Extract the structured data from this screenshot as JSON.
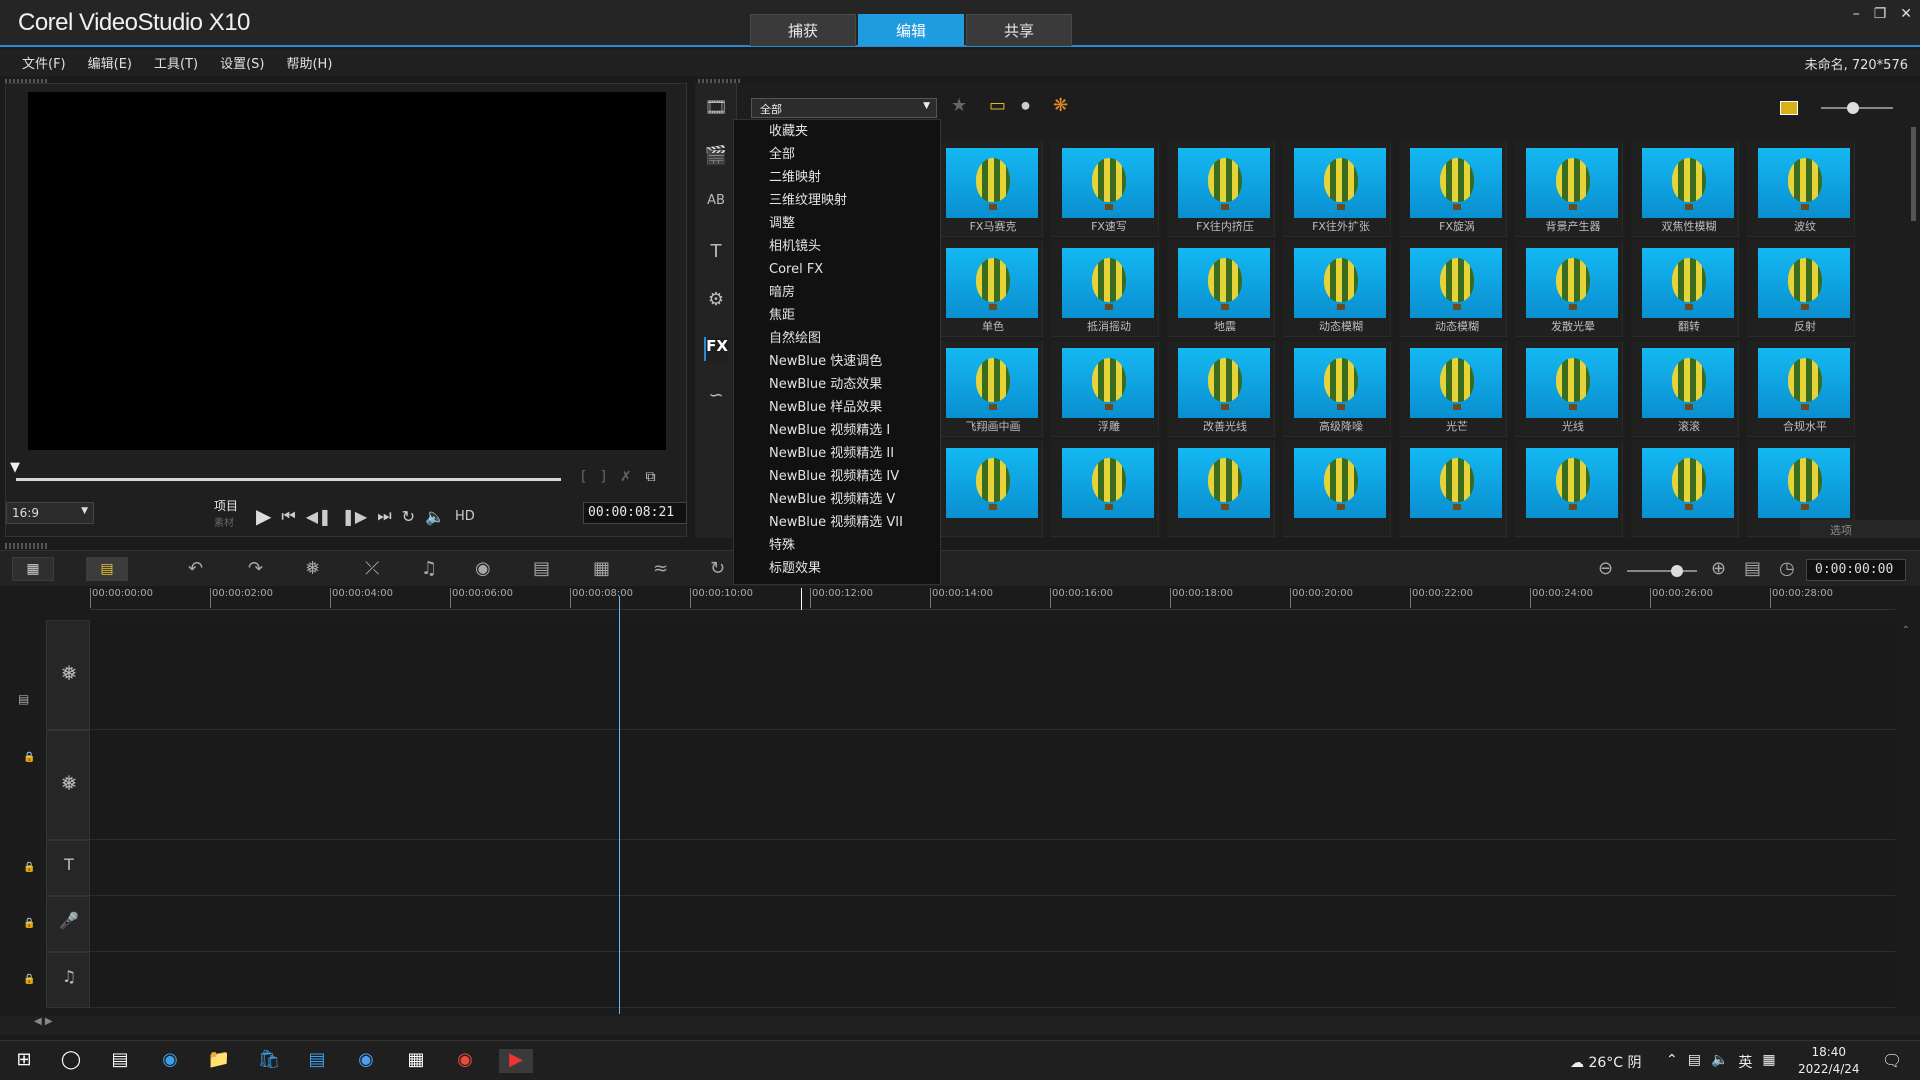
{
  "app": {
    "title": "Corel VideoStudio X10",
    "tabs": [
      "捕获",
      "编辑",
      "共享"
    ],
    "active_tab": "编辑",
    "project_info": "未命名, 720*576"
  },
  "menu": [
    "文件(F)",
    "编辑(E)",
    "工具(T)",
    "设置(S)",
    "帮助(H)"
  ],
  "preview": {
    "aspect": "16:9",
    "mode_label": "项目",
    "mode_sub": "素材",
    "timecode": "00:00:08:21",
    "hd_label": "HD"
  },
  "library": {
    "category_selected": "全部",
    "options_label": "选项",
    "dropdown_items": [
      "收藏夹",
      "全部",
      "二维映射",
      "三维纹理映射",
      "调整",
      "相机镜头",
      "Corel FX",
      "暗房",
      "焦距",
      "自然绘图",
      "NewBlue 快速调色",
      "NewBlue 动态效果",
      "NewBlue 样品效果",
      "NewBlue 视频精选 I",
      "NewBlue 视频精选 II",
      "NewBlue 视频精选 IV",
      "NewBlue 视频精选 V",
      "NewBlue 视频精选 VII",
      "特殊",
      "标题效果"
    ],
    "thumbs": [
      [
        "FX马赛克",
        "FX速写",
        "FX往内挤压",
        "FX往外扩张",
        "FX旋涡",
        "背景产生器",
        "双焦性模糊",
        "波纹"
      ],
      [
        "单色",
        "抵消摇动",
        "地震",
        "动态模糊",
        "动态模糊",
        "发散光晕",
        "翻转",
        "反射"
      ],
      [
        "飞翔画中画",
        "浮雕",
        "改善光线",
        "高级降噪",
        "光芒",
        "光线",
        "滚滚",
        "合规水平"
      ],
      [
        "",
        "",
        "",
        "",
        "",
        "",
        "",
        ""
      ]
    ]
  },
  "timeline": {
    "timecode": "0:00:00:00",
    "ruler_labels": [
      "00:00:00:00",
      "00:00:02:00",
      "00:00:04:00",
      "00:00:06:00",
      "00:00:08:00",
      "00:00:10:00",
      "00:00:12:00",
      "00:00:14:00",
      "00:00:16:00",
      "00:00:18:00",
      "00:00:20:00",
      "00:00:22:00",
      "00:00:24:00",
      "00:00:26:00",
      "00:00:28:00"
    ]
  },
  "taskbar": {
    "weather": "26°C 阴",
    "lang": "英",
    "time": "18:40",
    "date": "2022/4/24"
  }
}
